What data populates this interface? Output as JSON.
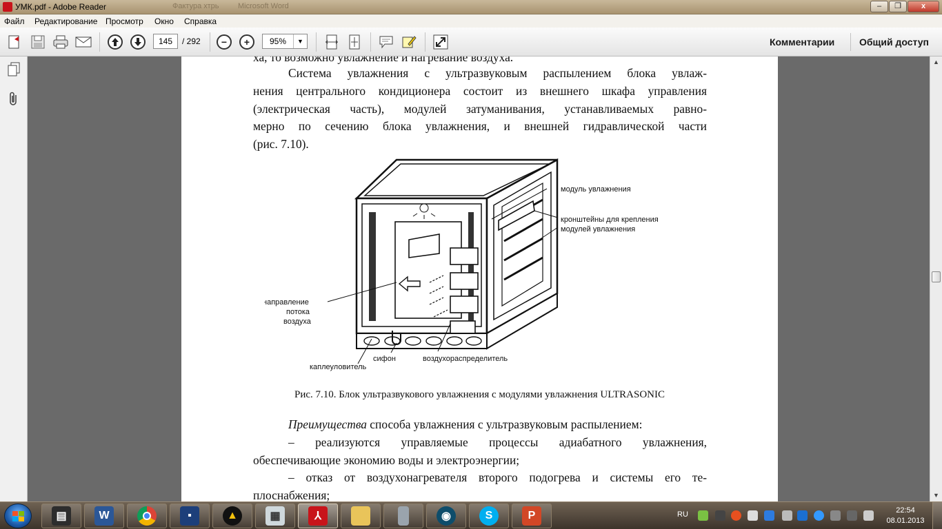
{
  "window": {
    "title": "УМК.pdf - Adobe Reader",
    "bg_titles": [
      "Фактура хтрь",
      "Microsoft Word"
    ],
    "minimize": "–",
    "maximize": "❐",
    "close": "x"
  },
  "menu": {
    "items": [
      "Файл",
      "Редактирование",
      "Просмотр",
      "Окно",
      "Справка"
    ]
  },
  "toolbar": {
    "page_current": "145",
    "page_total": "/ 292",
    "zoom": "95%",
    "zoom_out": "−",
    "zoom_in": "+",
    "comments_label": "Комментарии",
    "share_label": "Общий доступ"
  },
  "document": {
    "lines": [
      "ха, то возможно увлажнение и нагревание воздуха.",
      "Система увлажнения с ультразвуковым распылением блока увлаж-",
      "нения центрального кондиционера состоит из внешнего шкафа управления",
      "(электрическая часть), модулей затуманивания, устанавливаемых равно-",
      "мерно по сечению блока увлажнения, и внешней гидравлической части",
      "(рис. 7.10)."
    ],
    "figure_labels": {
      "module": "модуль увлажнения",
      "brackets_1": "кронштейны для крепления",
      "brackets_2": "модулей увлажнения",
      "flow_1": "направление",
      "flow_2": "потока",
      "flow_3": "воздуха",
      "drip": "каплеуловитель",
      "siphon": "сифон",
      "distributor": "воздухораспределитель"
    },
    "caption": "Рис. 7.10. Блок ультразвукового увлажнения с модулями увлажнения ULTRASONIC",
    "adv_italic": "Преимущества",
    "adv_rest": " способа увлажнения с ультразвуковым распылением:",
    "bullet1_a": "–   реализуются управляемые процессы адиабатного увлажнения,",
    "bullet1_b": "обеспечивающие экономию воды и электроэнергии;",
    "bullet2_a": "–   отказ от воздухонагревателя второго подогрева и системы его те-",
    "bullet2_b": "плоснабжения;"
  },
  "scrollbar": {
    "up": "▲",
    "down": "▼"
  },
  "taskbar": {
    "apps": [
      "Word",
      "Chrome",
      "Save",
      "Daemon",
      "Calculator",
      "Adobe Reader",
      "Folder",
      "Phone",
      "Media",
      "Skype",
      "PowerPoint"
    ],
    "tray_lang": "RU",
    "time": "22:54",
    "date": "08.01.2013"
  },
  "colors": {
    "adobe_red": "#c8141a",
    "word_blue": "#2b5797",
    "skype_blue": "#00aff0",
    "ppt_orange": "#d24726"
  }
}
